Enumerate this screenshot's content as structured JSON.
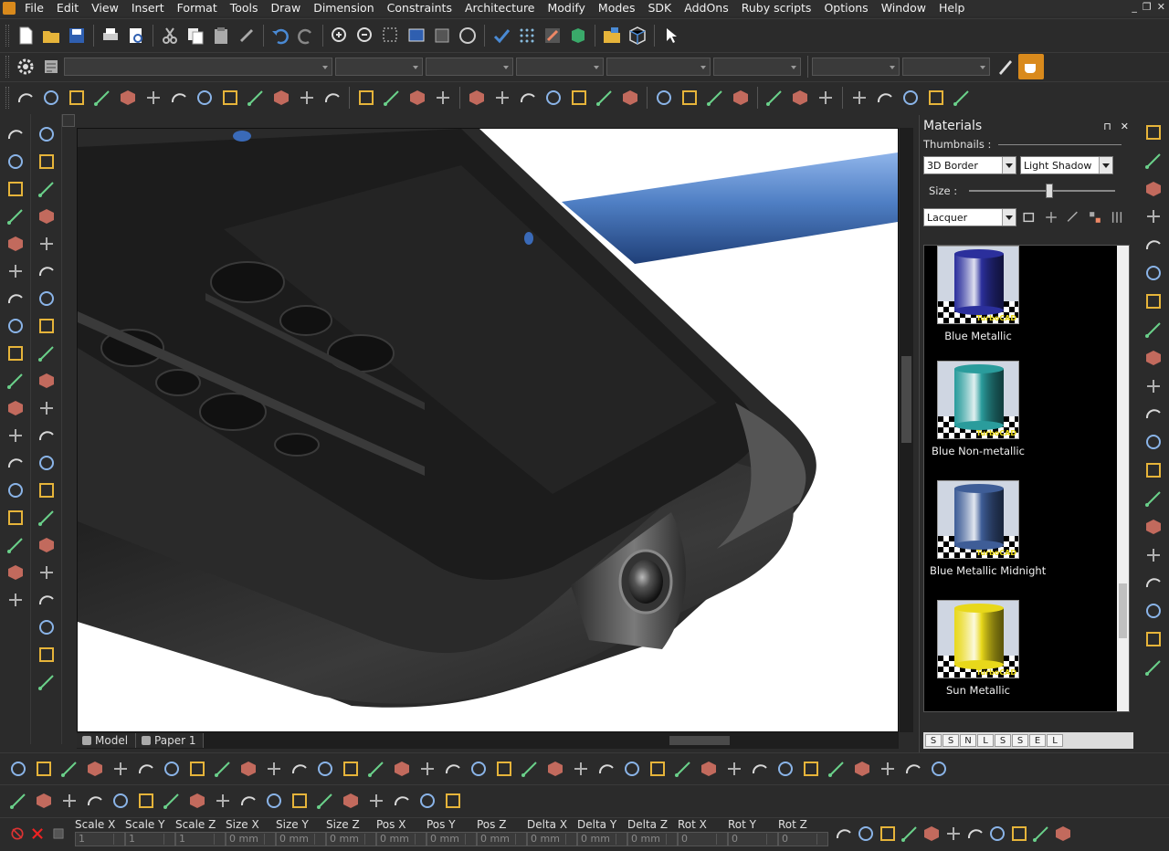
{
  "menu": {
    "items": [
      "File",
      "Edit",
      "View",
      "Insert",
      "Format",
      "Tools",
      "Draw",
      "Dimension",
      "Constraints",
      "Architecture",
      "Modify",
      "Modes",
      "SDK",
      "AddOns",
      "Ruby scripts",
      "Options",
      "Window",
      "Help"
    ],
    "window_controls": [
      "_",
      "❐",
      "✕"
    ]
  },
  "tabs": {
    "model": "Model",
    "paper": "Paper 1"
  },
  "materials": {
    "title": "Materials",
    "pin_glyph": "⊓",
    "close_glyph": "✕",
    "thumbnails_label": "Thumbnails :",
    "border_style": "3D Border",
    "shadow_style": "Light Shadow",
    "size_label": "Size :",
    "size_value": 0.55,
    "category": "Lacquer",
    "items": [
      {
        "name": "Blue Metallic",
        "color": "#2b2f9c"
      },
      {
        "name": "Blue Non-metallic",
        "color": "#2a9c9c"
      },
      {
        "name": "Blue Metallic Midnight",
        "color": "#3e5d97"
      },
      {
        "name": "Sun Metallic",
        "color": "#e8d81a"
      }
    ],
    "watermark": "TurboCAD",
    "bottom_icons": [
      "S",
      "S",
      "N",
      "L",
      "S",
      "S",
      "E",
      "L"
    ]
  },
  "status": {
    "fields": [
      {
        "label": "Scale X",
        "value": "1"
      },
      {
        "label": "Scale Y",
        "value": "1"
      },
      {
        "label": "Scale Z",
        "value": "1"
      },
      {
        "label": "Size X",
        "value": "0 mm"
      },
      {
        "label": "Size Y",
        "value": "0 mm"
      },
      {
        "label": "Size Z",
        "value": "0 mm"
      },
      {
        "label": "Pos X",
        "value": "0 mm"
      },
      {
        "label": "Pos Y",
        "value": "0 mm"
      },
      {
        "label": "Pos Z",
        "value": "0 mm"
      },
      {
        "label": "Delta X",
        "value": "0 mm"
      },
      {
        "label": "Delta Y",
        "value": "0 mm"
      },
      {
        "label": "Delta Z",
        "value": "0 mm"
      },
      {
        "label": "Rot X",
        "value": "0"
      },
      {
        "label": "Rot Y",
        "value": "0"
      },
      {
        "label": "Rot Z",
        "value": "0"
      }
    ]
  },
  "colors": {
    "accent": "#d98a1c",
    "viewport_bg": "#ffffff",
    "model_body": "#2a2a2a",
    "tube": "#4f7fc4"
  }
}
